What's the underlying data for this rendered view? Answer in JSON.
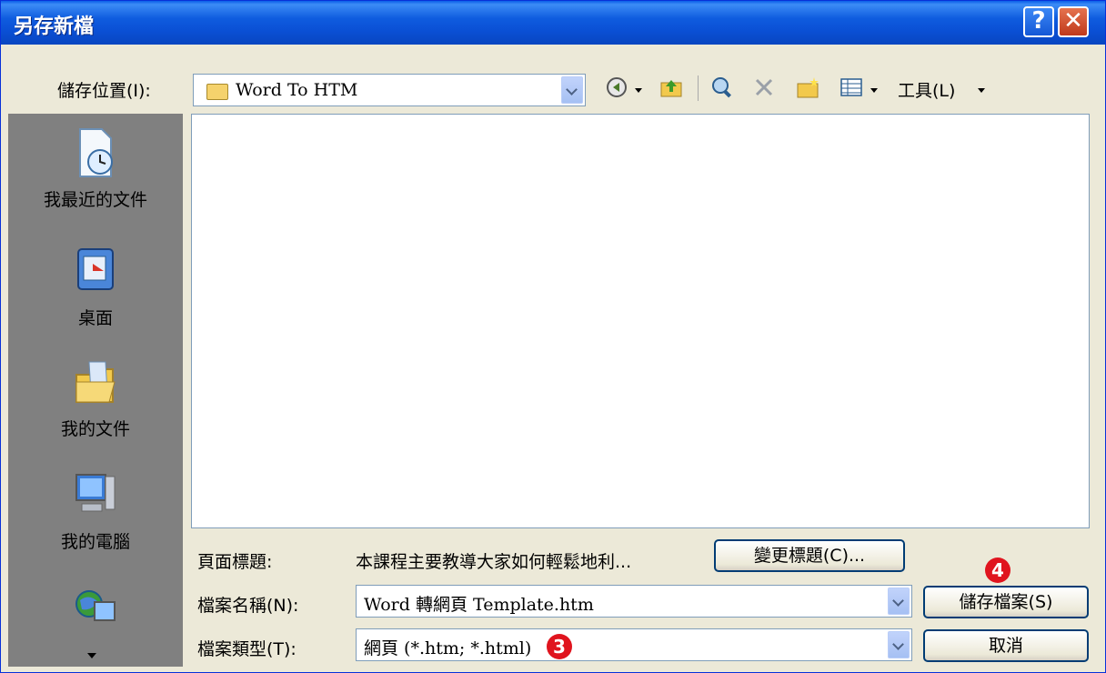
{
  "window": {
    "title": "另存新檔",
    "help_glyph": "?",
    "close_glyph": "✕"
  },
  "location": {
    "label": "儲存位置(I):",
    "value": "Word To HTM"
  },
  "toolbar": {
    "tools_label": "工具(L)"
  },
  "places": [
    {
      "label": "我最近的文件",
      "icon": "recent-documents-icon"
    },
    {
      "label": "桌面",
      "icon": "desktop-icon"
    },
    {
      "label": "我的文件",
      "icon": "my-documents-icon"
    },
    {
      "label": "我的電腦",
      "icon": "my-computer-icon"
    },
    {
      "label": "",
      "icon": "network-places-icon"
    }
  ],
  "page_title": {
    "label": "頁面標題:",
    "value": "本課程主要教導大家如何輕鬆地利...",
    "change_button": "變更標題(C)..."
  },
  "file_name": {
    "label": "檔案名稱(N):",
    "value": "Word 轉網頁 Template.htm"
  },
  "file_type": {
    "label": "檔案類型(T):",
    "value": "網頁 (*.htm; *.html)"
  },
  "buttons": {
    "save": "儲存檔案(S)",
    "cancel": "取消"
  },
  "annotations": {
    "step3": "3",
    "step4": "4"
  },
  "colors": {
    "title_bar": "#0a5fe8",
    "badge": "#e0141e",
    "dialog_bg": "#ece9d8"
  }
}
